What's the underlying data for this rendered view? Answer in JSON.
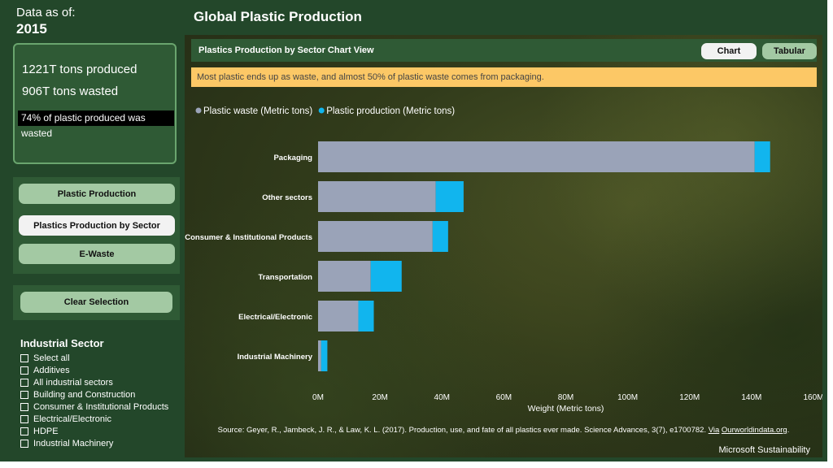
{
  "sidebar": {
    "data_as_of_label": "Data as of:",
    "year": "2015",
    "stats": {
      "produced": "1221T tons produced",
      "wasted": "906T tons wasted",
      "percent_wasted": "74% of plastic produced was wasted"
    },
    "nav": [
      {
        "label": "Plastic Production",
        "active": false
      },
      {
        "label": "Plastics Production by Sector",
        "active": true
      },
      {
        "label": "E-Waste",
        "active": false
      }
    ],
    "clear_label": "Clear Selection",
    "filter": {
      "title": "Industrial Sector",
      "items": [
        "Select all",
        "Additives",
        "All industrial sectors",
        "Building and Construction",
        "Consumer & Institutional Products",
        "Electrical/Electronic",
        "HDPE",
        "Industrial Machinery"
      ]
    }
  },
  "page_title": "Global Plastic Production",
  "chart_panel": {
    "title": "Plastics Production by Sector Chart View",
    "tabs": {
      "chart": "Chart",
      "tabular": "Tabular"
    },
    "banner": "Most plastic ends up as waste, and almost 50% of plastic waste comes from packaging.",
    "source_text": "Source: Geyer, R., Jambeck, J. R., & Law, K. L. (2017). Production, use, and fate of all plastics ever made. Science Advances, 3(7), e1700782.",
    "source_via": "Via",
    "source_link": "Ourworldindata.org",
    "source_end": ".",
    "footer": "Microsoft Sustainability"
  },
  "chart_data": {
    "type": "bar",
    "orientation": "horizontal",
    "stacked": true,
    "categories": [
      "Packaging",
      "Other sectors",
      "Consumer & Institutional Products",
      "Transportation",
      "Electrical/Electronic",
      "Industrial Machinery"
    ],
    "series": [
      {
        "name": "Plastic waste (Metric tons)",
        "color": "#9aa3b8",
        "values": [
          141,
          38,
          37,
          17,
          13,
          1
        ]
      },
      {
        "name": "Plastic production (Metric tons)",
        "color": "#11b5ee",
        "values": [
          5,
          9,
          5,
          10,
          5,
          2
        ]
      }
    ],
    "xlabel": "Weight (Metric tons)",
    "xlim": [
      0,
      160
    ],
    "x_ticks": [
      "0M",
      "20M",
      "40M",
      "60M",
      "80M",
      "100M",
      "120M",
      "140M",
      "160M"
    ],
    "legend_position": "top-left"
  }
}
